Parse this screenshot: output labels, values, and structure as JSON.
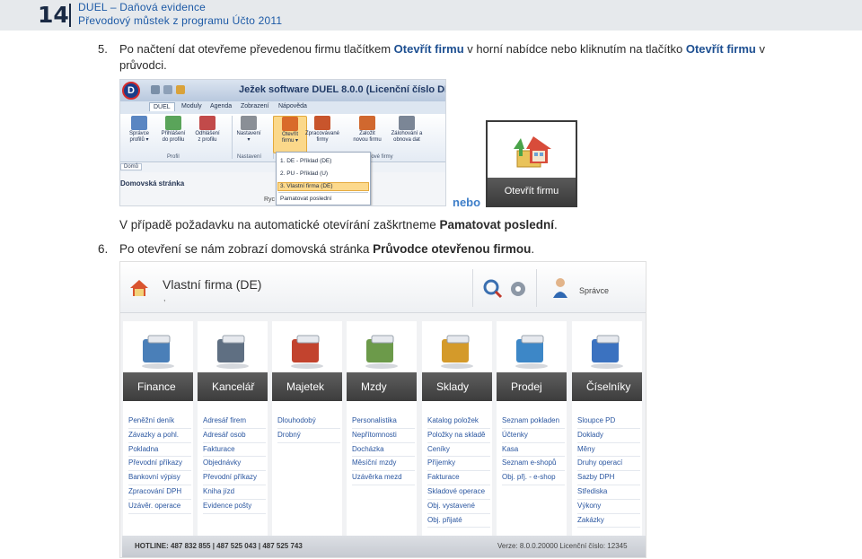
{
  "header": {
    "page_number": "14",
    "line1": "DUEL – Daňová evidence",
    "line2": "Převodový můstek z programu Účto 2011"
  },
  "step5": {
    "num": "5.",
    "text_a": "Po načtení dat otevřeme převedenou firmu tlačítkem ",
    "bold_a": "Otevřít firmu",
    "text_b": " v horní nabídce nebo kliknutím na tlačítko ",
    "bold_b": "Otevřít firmu",
    "text_c": " v",
    "line2": "průvodci."
  },
  "app": {
    "logo": "D",
    "title": "Ježek software DUEL 8.0.0 (Licenční číslo DL",
    "tabs": [
      "DUEL",
      "Moduly",
      "Agenda",
      "Zobrazení",
      "Nápověda"
    ],
    "ribbon": [
      {
        "label": "Správce\nprofilů ▾",
        "icon": "monitor-icon",
        "color": "#5a86c2"
      },
      {
        "label": "Přihlášení\ndo profilu",
        "icon": "login-icon",
        "color": "#5aa45a"
      },
      {
        "label": "Odhlášení\nz profilu",
        "icon": "logout-icon",
        "color": "#c24a4a"
      },
      {
        "label": "Nastavení\n▾",
        "icon": "settings-icon",
        "color": "#8a8f96"
      },
      {
        "label": "Otevřít\nfirmu ▾",
        "icon": "open-company-icon",
        "color": "#d96a2a"
      },
      {
        "label": "Zpracovávané\nfirmy",
        "icon": "companies-icon",
        "color": "#c8552c"
      },
      {
        "label": "Založit\nnovou firmu",
        "icon": "new-company-icon",
        "color": "#d0682f"
      },
      {
        "label": "Zálohování a\nobnova dat",
        "icon": "backup-icon",
        "color": "#7b8696"
      }
    ],
    "groups": [
      "Profil",
      "Nastavení",
      "Nové firmy"
    ],
    "home_tab": "Domů",
    "home_page": "Domovská stránka",
    "ry_text": "Ryc",
    "dropdown": [
      "1. DE - Příklad (DE)",
      "2. PU - Příklad (U)",
      "3. Vlastní firma (DE)",
      "Pamatovat poslední"
    ]
  },
  "nebo": "nebo",
  "open_button_label": "Otevřít firmu",
  "remember_note": {
    "text": "V případě požadavku na automatické otevírání zaškrtneme ",
    "bold": "Pamatovat poslední",
    "end": "."
  },
  "step6": {
    "num": "6.",
    "text": "Po otevření se nám zobrazí domovská stránka ",
    "bold": "Průvodce otevřenou firmou",
    "end": "."
  },
  "dashboard": {
    "company": "Vlastní firma (DE)",
    "company_sub": ",",
    "user": "Správce",
    "modules": [
      {
        "name": "Finance",
        "color": "#4a7fb8",
        "items": [
          "Peněžní deník",
          "Závazky a pohl.",
          "Pokladna",
          "Převodní příkazy",
          "Bankovní výpisy",
          "Zpracování DPH",
          "Uzávěr. operace"
        ]
      },
      {
        "name": "Kancelář",
        "color": "#5f6f82",
        "items": [
          "Adresář firem",
          "Adresář osob",
          "Fakturace",
          "Objednávky",
          "Převodní příkazy",
          "Kniha jízd",
          "Evidence pošty"
        ]
      },
      {
        "name": "Majetek",
        "color": "#c2432e",
        "items": [
          "Dlouhodobý",
          "Drobný"
        ]
      },
      {
        "name": "Mzdy",
        "color": "#6c9a4a",
        "items": [
          "Personalistika",
          "Nepřítomnosti",
          "Docházka",
          "Měsíční mzdy",
          "Uzávěrka mezd"
        ]
      },
      {
        "name": "Sklady",
        "color": "#d49a2a",
        "items": [
          "Katalog položek",
          "Položky na skladě",
          "Ceníky",
          "Příjemky",
          "Fakturace",
          "Skladové operace",
          "Obj. vystavené",
          "Obj. přijaté"
        ]
      },
      {
        "name": "Prodej",
        "color": "#3d87c7",
        "items": [
          "Seznam pokladen",
          "Účtenky",
          "Kasa",
          "Seznam e-shopů",
          "Obj. přj. - e-shop"
        ]
      },
      {
        "name": "Číselníky",
        "color": "#3b72c0",
        "items": [
          "Sloupce PD",
          "Doklady",
          "Měny",
          "Druhy operací",
          "Sazby DPH",
          "Střediska",
          "Výkony",
          "Zakázky"
        ]
      }
    ],
    "hotline": "HOTLINE:  487 832 855  |  487 525 043  |  487 525 743",
    "version": "Verze: 8.0.0.20000   Licenční číslo: 12345"
  }
}
